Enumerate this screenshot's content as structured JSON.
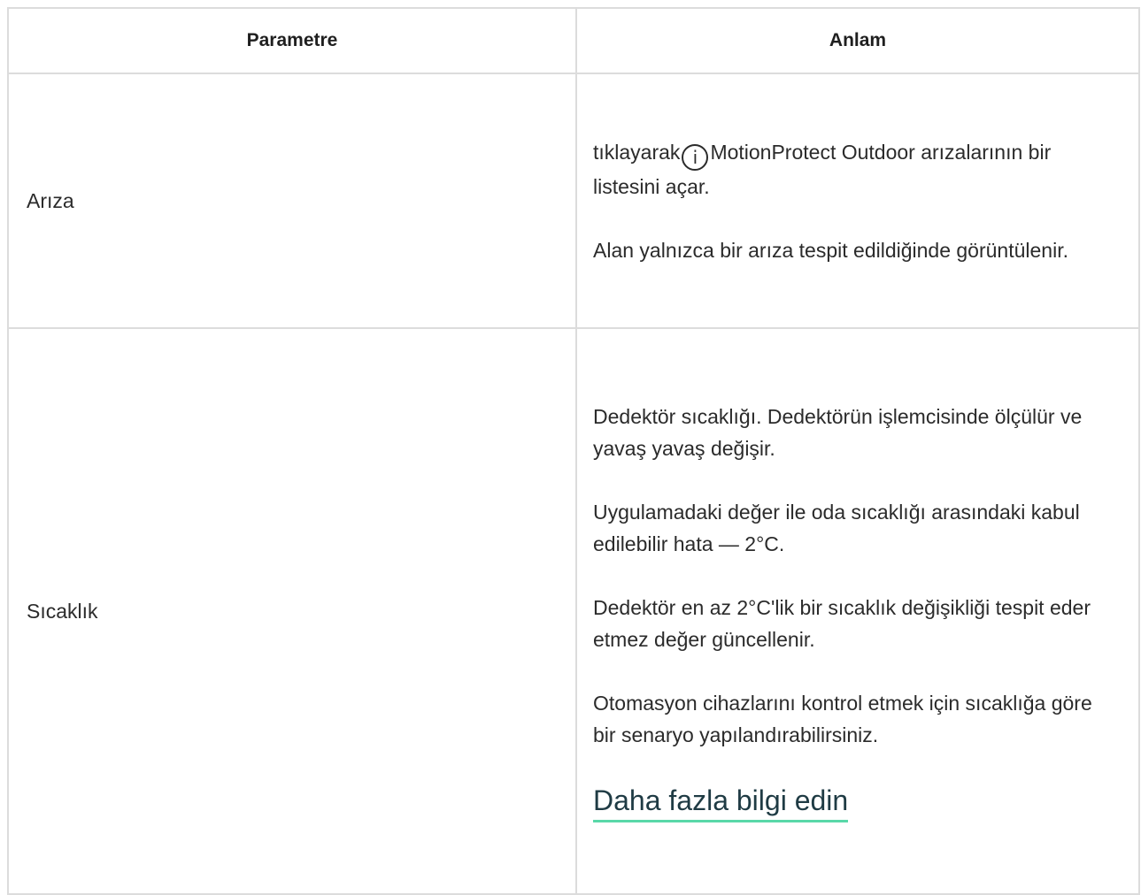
{
  "table": {
    "headers": {
      "parameter": "Parametre",
      "meaning": "Anlam"
    },
    "rows": [
      {
        "parameter": "Arıza",
        "paragraphs": [
          {
            "before_icon": "tıklayarak",
            "icon": "i",
            "after_icon": "MotionProtect Outdoor arızalarının bir listesini açar."
          },
          "Alan yalnızca bir arıza tespit edildiğinde görüntülenir."
        ]
      },
      {
        "parameter": "Sıcaklık",
        "paragraphs": [
          "Dedektör sıcaklığı. Dedektörün işlemcisinde ölçülür ve yavaş yavaş değişir.",
          "Uygulamadaki değer ile oda sıcaklığı arasındaki kabul edilebilir hata — 2°C.",
          "Dedektör en az 2°C'lik bir sıcaklık değişikliği tespit eder etmez değer güncellenir.",
          "Otomasyon cihazlarını kontrol etmek için sıcaklığa göre bir senaryo yapılandırabilirsiniz."
        ],
        "link": "Daha fazla bilgi edin"
      }
    ]
  },
  "colors": {
    "border": "#dcdcdc",
    "link_underline": "#59d8a8",
    "text": "#2b2b2b"
  }
}
